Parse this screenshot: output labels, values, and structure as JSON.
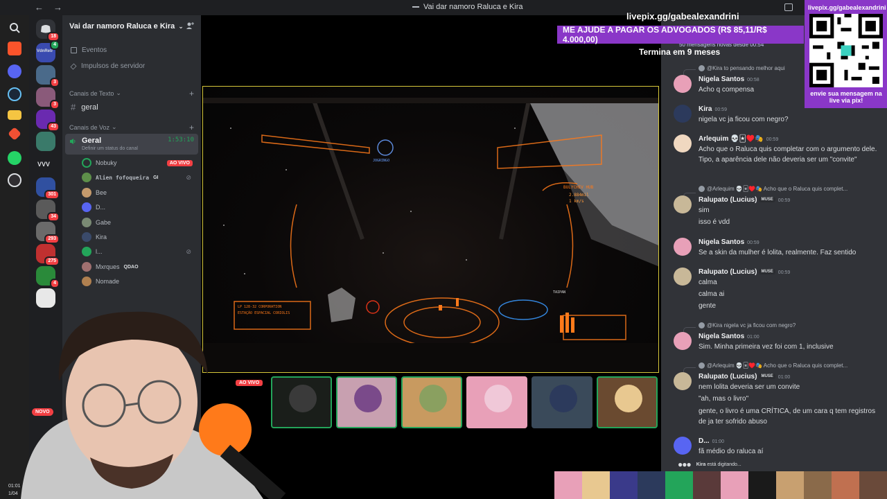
{
  "titlebar": {
    "window_title": "Vai dar namoro Raluca e Kira",
    "back": "←",
    "forward": "→"
  },
  "taskbar": {
    "icons": [
      "windows-icon",
      "search-icon",
      "brave-icon",
      "discord-icon",
      "steam-icon",
      "folder-icon",
      "git-icon",
      "whatsapp-icon",
      "obs-icon"
    ]
  },
  "servers": {
    "items": [
      {
        "badge": "18"
      },
      {
        "label": "VdnRetr",
        "badge": "4"
      },
      {
        "badge": "3"
      },
      {
        "badge": "3"
      },
      {
        "badge": "43"
      },
      {
        "badge": ""
      },
      {
        "label": "VVV",
        "badge": ""
      },
      {
        "badge": "301"
      },
      {
        "badge": "34"
      },
      {
        "badge": "293"
      },
      {
        "badge": "275"
      },
      {
        "badge": "4"
      },
      {
        "badge": ""
      }
    ],
    "new_label": "NOVO"
  },
  "guild": {
    "name": "Vai dar namoro Raluca e Kira",
    "events": "Eventos",
    "boosts": "Impulsos de servidor",
    "text_category": "Canais de Texto",
    "text_channel": "geral",
    "voice_category": "Canais de Voz",
    "voice_channel": "Geral",
    "voice_timer": "1:53:10",
    "voice_status": "Definir um status do canal"
  },
  "voice_users": [
    {
      "name": "Nobuky",
      "live": "AO VIVO",
      "color": "#23a55a"
    },
    {
      "name": "Alien fofoqueira",
      "tag": "GI",
      "color": "#5e8f4a"
    },
    {
      "name": "Bee",
      "color": "#c49a6c"
    },
    {
      "name": "D...",
      "color": "#5865f2"
    },
    {
      "name": "Gabe",
      "color": "#7a8a74"
    },
    {
      "name": "Kira",
      "color": "#3a4a6a"
    },
    {
      "name": "l...",
      "color": "#23a55a"
    },
    {
      "name": "Mxrques",
      "tag": "QDAO",
      "color": "#a07070"
    },
    {
      "name": "Nomade",
      "color": "#b08050"
    }
  ],
  "stage": {
    "live_badge": "AO VIVO",
    "game_hud": {
      "target": "BULYCHEV HUB",
      "distance": "2.884mil",
      "speed": "1 km/s",
      "station": "ESTAÇÃO ESPACIAL CORIOLIS",
      "corp": "LP 128-32 CORPORATION",
      "right_panel": "TAIPAN",
      "jogringo": "JOGRINGO"
    }
  },
  "overlay": {
    "url": "livepix.gg/gabealexandrini",
    "goal": "ME AJUDE A PAGAR OS ADVOGADOS (R$ 85,11/R$ 4.000,00)",
    "ends": "Termina em 9 meses",
    "qr_url": "livepix.gg/gabealexandrini",
    "qr_msg": "envie sua mensagem na live via pix!"
  },
  "chat": {
    "new_messages": "50 mensagens novas desde 00:54",
    "messages": [
      {
        "reply": "@Kira to pensando melhor aqui",
        "user": "Nigela Santos",
        "time": "00:58",
        "lines": [
          "Acho q compensa"
        ],
        "color": "#e8a0b8"
      },
      {
        "user": "Kira",
        "time": "00:59",
        "lines": [
          "nigela vc ja ficou com negro?"
        ],
        "color": "#2c3a5c"
      },
      {
        "user": "Arlequim 💀🃏♥️🎭",
        "time": "00:59",
        "lines": [
          "Acho que o Raluca quis completar com o argumento dele. Tipo, a aparência dele não deveria ser um \"convite\""
        ],
        "color": "#f0d8c0"
      },
      {
        "reply": "@Arlequim 💀🃏♥️🎭 Acho que o Raluca quis complet...",
        "user": "Ralupato (Lucius)",
        "muse": "MUSE",
        "time": "00:59",
        "lines": [
          "sim",
          "isso é vdd"
        ],
        "color": "#c8b898"
      },
      {
        "user": "Nigela Santos",
        "time": "00:59",
        "lines": [
          "Se a skin da mulher é lolita, realmente. Faz sentido"
        ],
        "color": "#e8a0b8"
      },
      {
        "user": "Ralupato (Lucius)",
        "muse": "MUSE",
        "time": "00:59",
        "lines": [
          "calma",
          "calma ai",
          "gente"
        ],
        "color": "#c8b898"
      },
      {
        "reply": "@Kira nigela vc ja ficou com negro?",
        "user": "Nigela Santos",
        "time": "01:00",
        "lines": [
          "Sim. Minha primeira vez foi com 1, inclusive"
        ],
        "color": "#e8a0b8"
      },
      {
        "reply": "@Arlequim 💀🃏♥️🎭 Acho que o Raluca quis complet...",
        "user": "Ralupato (Lucius)",
        "muse": "MUSE",
        "time": "01:00",
        "lines": [
          "nem lolita deveria ser um convite",
          "\"ah, mas o livro\"",
          "gente, o livro é uma CRÍTICA, de um cara q tem registros de ja ter sofrido abuso"
        ],
        "color": "#c8b898"
      },
      {
        "user": "D...",
        "time": "01:00",
        "lines": [
          "fã médio do raluca aí"
        ],
        "color": "#5865f2"
      }
    ],
    "typing_user": "Kira",
    "typing_text": "está digitando..."
  },
  "webcam": {
    "time": "01:01",
    "date": "1/04"
  }
}
